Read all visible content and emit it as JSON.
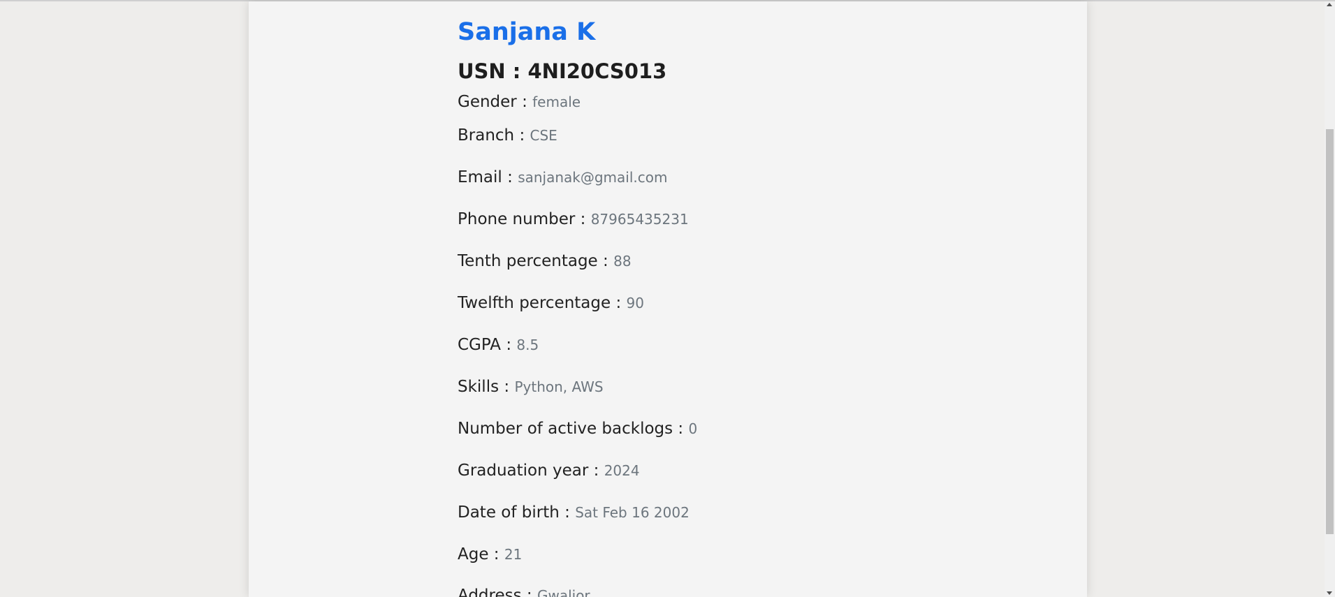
{
  "colors": {
    "name": "#1a6fe8",
    "value": "#6c757d"
  },
  "student": {
    "name": "Sanjana K",
    "usn": "USN : 4NI20CS013",
    "fields": [
      {
        "label": "Gender : ",
        "value": "female"
      },
      {
        "label": "Branch : ",
        "value": "CSE"
      },
      {
        "label": "Email : ",
        "value": "sanjanak@gmail.com"
      },
      {
        "label": "Phone number : ",
        "value": "87965435231"
      },
      {
        "label": "Tenth percentage : ",
        "value": "88"
      },
      {
        "label": "Twelfth percentage : ",
        "value": "90"
      },
      {
        "label": "CGPA : ",
        "value": "8.5"
      },
      {
        "label": "Skills : ",
        "value": "Python, AWS"
      },
      {
        "label": "Number of active backlogs : ",
        "value": "0"
      },
      {
        "label": "Graduation year : ",
        "value": "2024"
      },
      {
        "label": "Date of birth : ",
        "value": "Sat Feb 16 2002"
      },
      {
        "label": "Age : ",
        "value": "21"
      },
      {
        "label": "Address : ",
        "value": "Gwalior"
      }
    ]
  }
}
